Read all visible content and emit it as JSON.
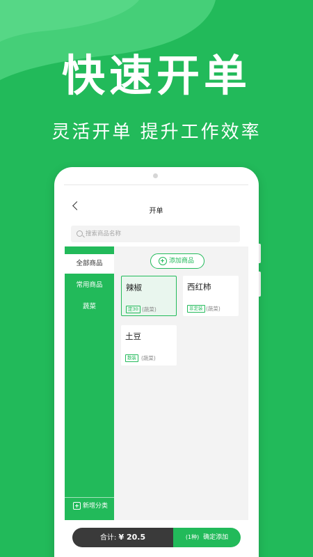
{
  "hero": {
    "title": "快速开单",
    "subtitle": "灵活开单 提升工作效率"
  },
  "nav": {
    "title": "开单"
  },
  "search": {
    "placeholder": "搜索商品名称"
  },
  "sidebar": {
    "categories": [
      {
        "label": "全部商品",
        "active": true
      },
      {
        "label": "常用商品",
        "active": false
      },
      {
        "label": "蔬菜",
        "active": false
      }
    ],
    "add_category_label": "新增分类"
  },
  "content": {
    "add_product_label": "添加商品",
    "products": [
      {
        "name": "辣椒",
        "tag": "定30",
        "category": "(蔬菜)",
        "selected": true
      },
      {
        "name": "西红柿",
        "tag": "非定装",
        "category": "(蔬菜)",
        "selected": false
      },
      {
        "name": "土豆",
        "tag": "散装",
        "category": "(蔬菜)",
        "selected": false
      }
    ]
  },
  "footer": {
    "total_label": "合计:",
    "total_amount": "¥ 20.5",
    "confirm_count": "(1种)",
    "confirm_label": "确定添加"
  },
  "colors": {
    "brand_green": "#22ba5a",
    "dark": "#3a3a3a"
  },
  "icons": [
    "chevron-left-icon",
    "search-icon",
    "plus-circle-icon",
    "plus-box-icon"
  ]
}
